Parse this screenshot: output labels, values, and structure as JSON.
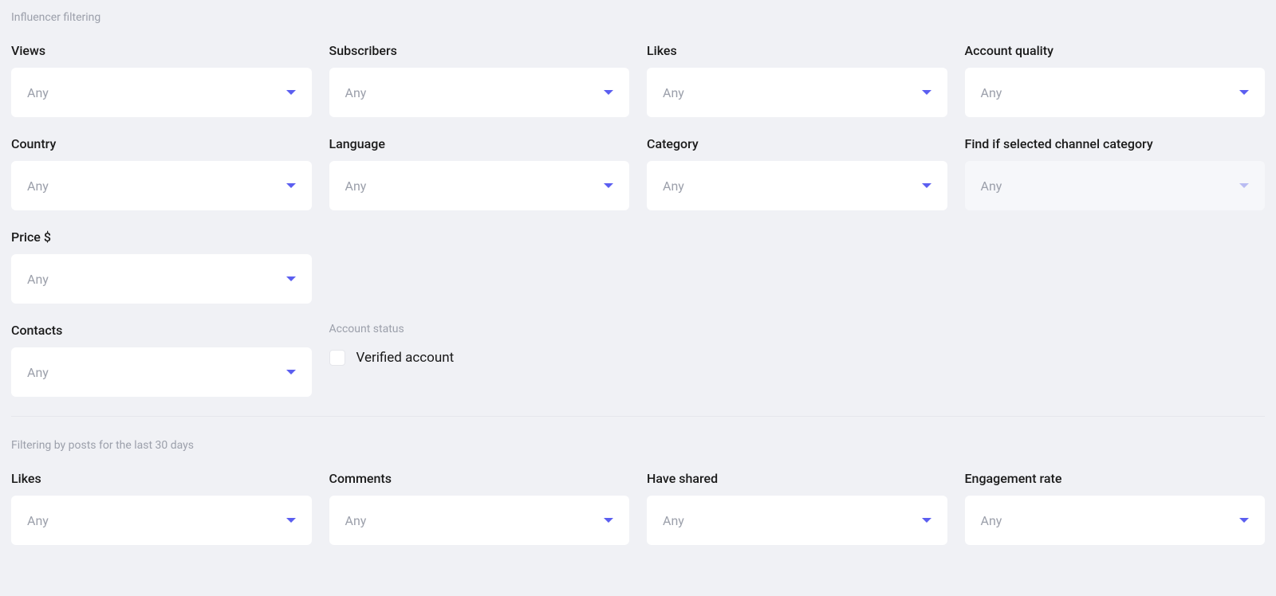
{
  "section1": {
    "title": "Influencer filtering",
    "filters": {
      "views": {
        "label": "Views",
        "value": "Any"
      },
      "subscribers": {
        "label": "Subscribers",
        "value": "Any"
      },
      "likes": {
        "label": "Likes",
        "value": "Any"
      },
      "account_quality": {
        "label": "Account quality",
        "value": "Any"
      },
      "country": {
        "label": "Country",
        "value": "Any"
      },
      "language": {
        "label": "Language",
        "value": "Any"
      },
      "category": {
        "label": "Category",
        "value": "Any"
      },
      "find_if_selected": {
        "label": "Find if selected channel category",
        "value": "Any",
        "disabled": true
      },
      "price": {
        "label": "Price $",
        "value": "Any"
      },
      "contacts": {
        "label": "Contacts",
        "value": "Any"
      }
    },
    "account_status": {
      "label": "Account status",
      "checkbox_label": "Verified account",
      "checked": false
    }
  },
  "section2": {
    "title": "Filtering by posts for the last 30 days",
    "filters": {
      "likes": {
        "label": "Likes",
        "value": "Any"
      },
      "comments": {
        "label": "Comments",
        "value": "Any"
      },
      "have_shared": {
        "label": "Have shared",
        "value": "Any"
      },
      "engagement_rate": {
        "label": "Engagement rate",
        "value": "Any"
      }
    }
  }
}
